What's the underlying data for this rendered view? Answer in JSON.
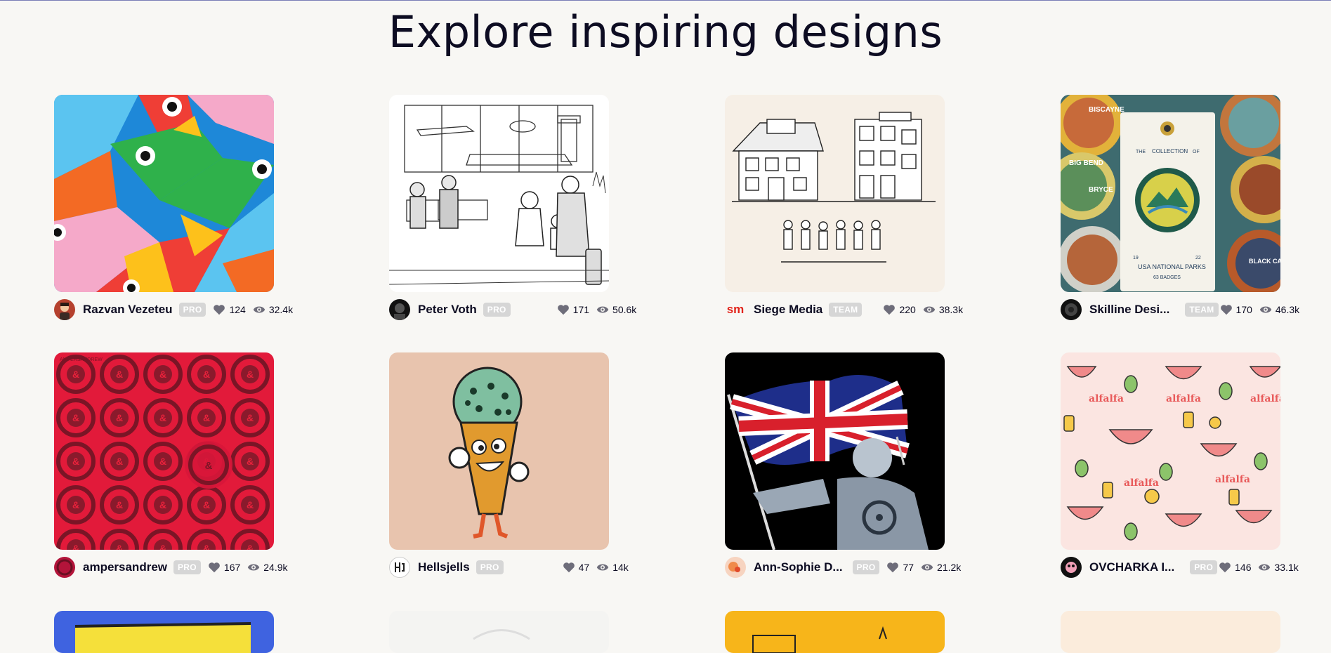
{
  "page": {
    "heading": "Explore inspiring designs"
  },
  "shots": [
    {
      "author": "Razvan Vezeteu",
      "badge": "PRO",
      "likes": "124",
      "views": "32.4k"
    },
    {
      "author": "Peter Voth",
      "badge": "PRO",
      "likes": "171",
      "views": "50.6k"
    },
    {
      "author": "Siege Media",
      "badge": "TEAM",
      "likes": "220",
      "views": "38.3k",
      "avatar_text": "sm"
    },
    {
      "author": "Skilline Desi...",
      "badge": "TEAM",
      "likes": "170",
      "views": "46.3k"
    },
    {
      "author": "ampersandrew",
      "badge": "PRO",
      "likes": "167",
      "views": "24.9k"
    },
    {
      "author": "Hellsjells",
      "badge": "PRO",
      "likes": "47",
      "views": "14k"
    },
    {
      "author": "Ann-Sophie D...",
      "badge": "PRO",
      "likes": "77",
      "views": "21.2k"
    },
    {
      "author": "OVCHARKA I...",
      "badge": "PRO",
      "likes": "146",
      "views": "33.1k"
    }
  ],
  "thumb_text": {
    "skilline_card": [
      "THE",
      "COLLECTION",
      "OF",
      "USA NATIONAL PARKS",
      "63 BADGES",
      "19",
      "22"
    ],
    "skilline_badges": [
      "BIG BEND",
      "BRYCE",
      "BISCAYNE",
      "BLACK CANYON"
    ],
    "ampersand_ring": "AMPERSANDREW",
    "ampersand_center": "&",
    "alfalfa": "alfalfa"
  },
  "colors": {
    "background": "#f8f7f4",
    "badge": "#d6d6d6",
    "text": "#0d0c22"
  }
}
